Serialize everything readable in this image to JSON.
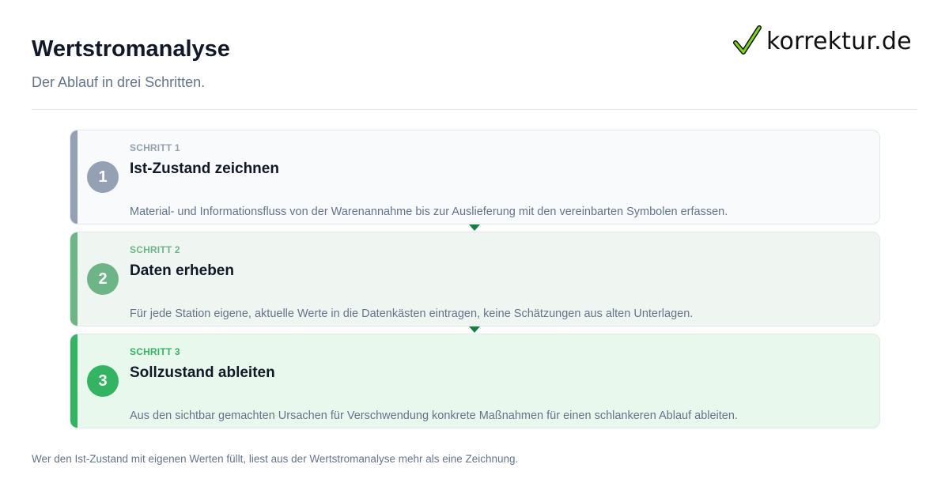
{
  "header": {
    "title": "Wertstromanalyse",
    "subtitle": "Der Ablauf in drei Schritten."
  },
  "logo": {
    "text": "korrektur.de",
    "icon": "checkmark-icon",
    "icon_color": "#7ed321"
  },
  "steps": [
    {
      "number": "1",
      "label": "SCHRITT 1",
      "title": "Ist-Zustand zeichnen",
      "description": "Material- und Informationsfluss von der Warenannahme bis zur Auslieferung mit den vereinbarten Symbolen erfassen.",
      "color": "#94a0b4"
    },
    {
      "number": "2",
      "label": "SCHRITT 2",
      "title": "Daten erheben",
      "description": "Für jede Station eigene, aktuelle Werte in die Datenkästen eintragen, keine Schätzungen aus alten Unterlagen.",
      "color": "#6db586"
    },
    {
      "number": "3",
      "label": "SCHRITT 3",
      "title": "Sollzustand ableiten",
      "description": "Aus den sichtbar gemachten Ursachen für Verschwendung konkrete Maßnahmen für einen schlankeren Ablauf ableiten.",
      "color": "#34b462"
    }
  ],
  "connector": {
    "icon": "arrow-down-icon",
    "color": "#15803d"
  },
  "footer": {
    "note": "Wer den Ist-Zustand mit eigenen Werten füllt, liest aus der Wertstromanalyse mehr als eine Zeichnung."
  }
}
